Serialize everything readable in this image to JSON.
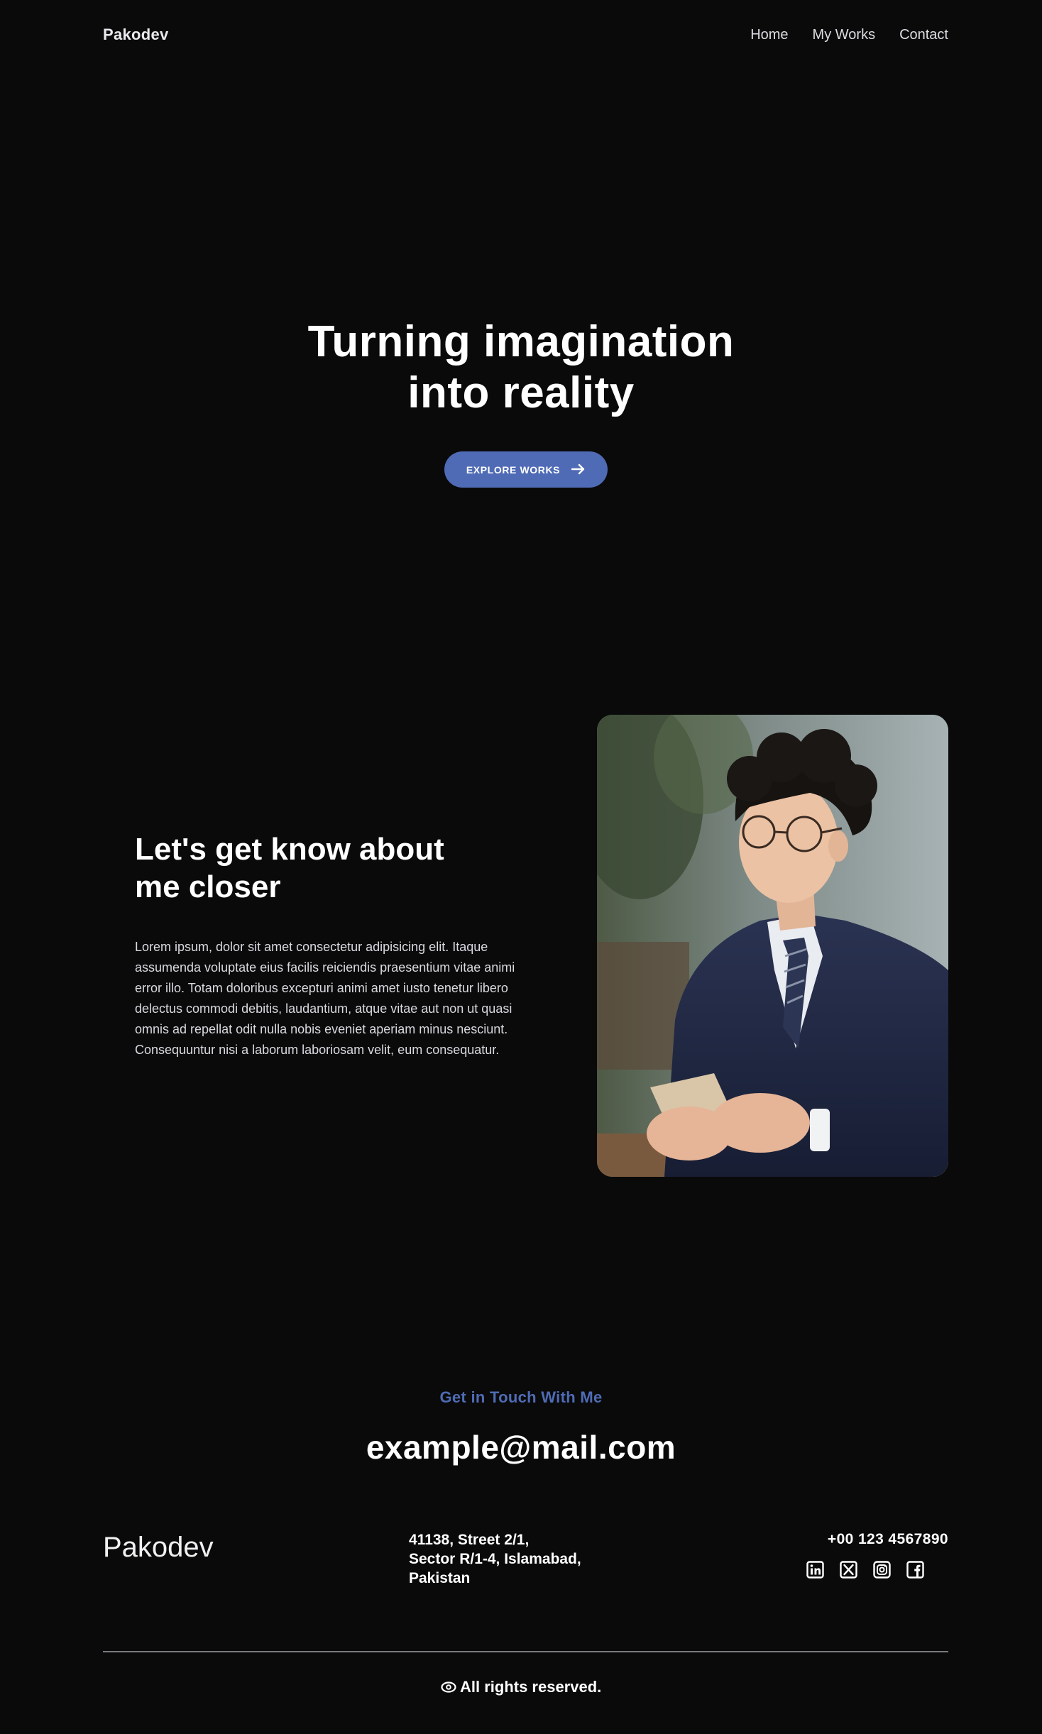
{
  "header": {
    "brand": "Pakodev",
    "nav": [
      "Home",
      "My Works",
      "Contact"
    ]
  },
  "hero": {
    "title_lines": [
      "Turning imagination",
      "into reality"
    ],
    "cta_label": "EXPLORE WORKS",
    "cta_icon": "arrow-right-icon"
  },
  "about": {
    "title_lines": [
      "Let's get know about",
      "me closer"
    ],
    "paragraph_lines": [
      "Lorem ipsum, dolor sit amet consectetur adipisicing elit. Itaque",
      "assumenda voluptate eius facilis reiciendis praesentium vitae animi",
      "error illo. Totam doloribus excepturi animi amet iusto tenetur libero",
      "delectus commodi debitis, laudantium, atque vitae aut non ut quasi",
      "omnis ad repellat odit nulla nobis eveniet aperiam minus nesciunt.",
      "Consequuntur nisi a laborum laboriosam velit, eum consequatur."
    ]
  },
  "contact": {
    "heading": "Get in Touch With Me",
    "email": "example@mail.com"
  },
  "footer": {
    "brand": "Pakodev",
    "address_lines": [
      "41138, Street 2/1,",
      "Sector R/1-4, Islamabad,",
      "Pakistan"
    ],
    "phone": "+00 123 4567890",
    "socials": [
      "linkedin-icon",
      "x-icon",
      "instagram-icon",
      "facebook-icon"
    ],
    "copyright": "All rights reserved.",
    "copyright_icon": "copyright-icon"
  },
  "colors": {
    "background": "#0a0a0a",
    "accent": "#4f6bb5",
    "text": "#ffffff"
  }
}
